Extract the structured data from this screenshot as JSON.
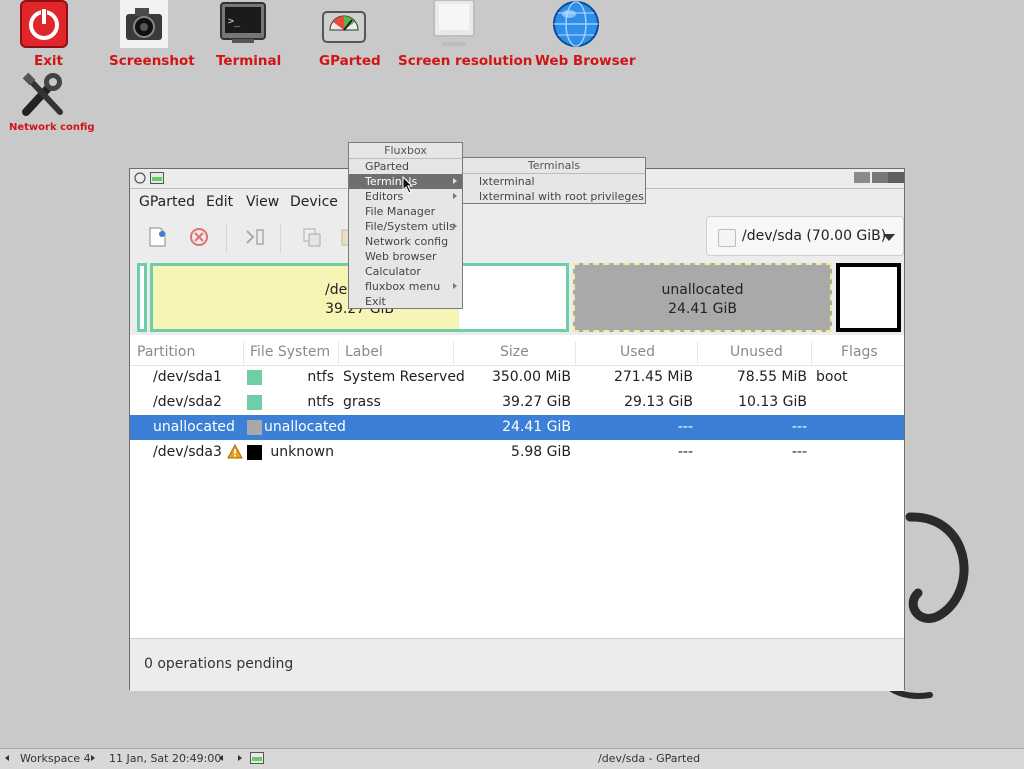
{
  "desktop": {
    "icons": [
      {
        "label": "Exit",
        "icon": "power-icon"
      },
      {
        "label": "Screenshot",
        "icon": "camera-icon"
      },
      {
        "label": "Terminal",
        "icon": "terminal-icon"
      },
      {
        "label": "GParted",
        "icon": "gparted-icon"
      },
      {
        "label": "Screen resolution",
        "icon": "monitor-icon"
      },
      {
        "label": "Web Browser",
        "icon": "globe-icon"
      },
      {
        "label": "Network config",
        "icon": "wrench-icon"
      }
    ],
    "label_color": "#d11414"
  },
  "window": {
    "menu": [
      "GParted",
      "Edit",
      "View",
      "Device"
    ],
    "device_selector": "/dev/sda  (70.00 GiB)",
    "toolbar_icons": [
      "new-icon",
      "delete-icon",
      "resize-move-icon",
      "copy-icon",
      "paste-icon"
    ]
  },
  "partition_map": {
    "sda2_label": "/dev/sda2",
    "sda2_size": "39.27 GiB",
    "unallocated_label": "unallocated",
    "unallocated_size": "24.41 GiB"
  },
  "table": {
    "columns": [
      "Partition",
      "File System",
      "Label",
      "Size",
      "Used",
      "Unused",
      "Flags"
    ],
    "rows": [
      {
        "partition": "/dev/sda1",
        "fs": "ntfs",
        "label": "System Reserved",
        "size": "350.00 MiB",
        "used": "271.45 MiB",
        "unused": "78.55 MiB",
        "flags": "boot",
        "fs_color": "#6ecfa7"
      },
      {
        "partition": "/dev/sda2",
        "fs": "ntfs",
        "label": "grass",
        "size": "39.27 GiB",
        "used": "29.13 GiB",
        "unused": "10.13 GiB",
        "flags": "",
        "fs_color": "#6ecfa7"
      },
      {
        "partition": "unallocated",
        "fs": "unallocated",
        "label": "",
        "size": "24.41 GiB",
        "used": "---",
        "unused": "---",
        "flags": "",
        "fs_color": "#a8a8a8"
      },
      {
        "partition": "/dev/sda3",
        "fs": "unknown",
        "label": "",
        "size": "5.98 GiB",
        "used": "---",
        "unused": "---",
        "flags": "",
        "fs_color": "#000000"
      }
    ],
    "selected_row": 2
  },
  "status": "0 operations pending",
  "fluxbox_menu": {
    "title": "Fluxbox",
    "items": [
      "GParted",
      "Terminals",
      "Editors",
      "File Manager",
      "File/System utils",
      "Network config",
      "Web browser",
      "Calculator",
      "fluxbox menu",
      "Exit"
    ],
    "highlighted": "Terminals"
  },
  "terminals_submenu": {
    "title": "Terminals",
    "items": [
      "lxterminal",
      "lxterminal with root privileges"
    ]
  },
  "taskbar": {
    "workspace": "Workspace 4",
    "clock": "11 Jan, Sat 20:49:00",
    "task": "/dev/sda - GParted"
  },
  "colors": {
    "selection": "#3b7fd6",
    "ntfs": "#6ecfa7",
    "map_used": "#f7f5b5",
    "unallocated": "#a8a8a8"
  }
}
